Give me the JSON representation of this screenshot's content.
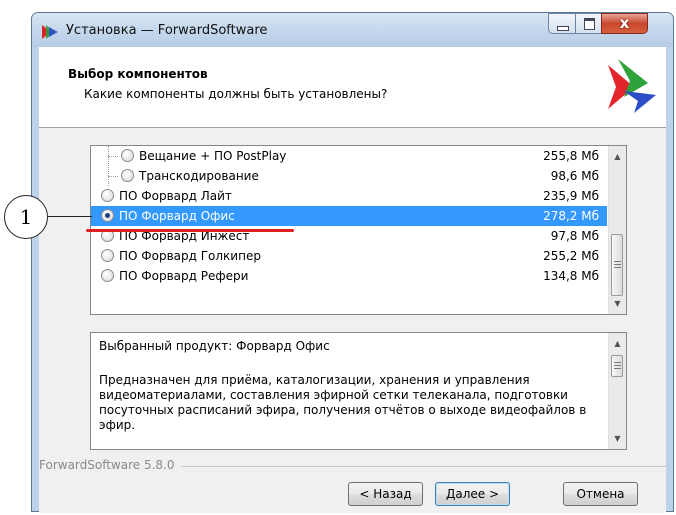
{
  "window": {
    "title": "Установка — ForwardSoftware",
    "controls": [
      "minimize",
      "maximize",
      "close"
    ],
    "close_glyph": "x"
  },
  "header": {
    "title": "Выбор компонентов",
    "subtitle": "Какие компоненты должны быть установлены?",
    "logo_icon": "tricolor-arrows-logo"
  },
  "components": {
    "items": [
      {
        "label": "Вещание + ПО PostPlay",
        "size": "255,8 Мб",
        "indent": true,
        "checked": false,
        "selected": false
      },
      {
        "label": "Транскодирование",
        "size": "98,6 Мб",
        "indent": true,
        "checked": false,
        "selected": false
      },
      {
        "label": "ПО Форвард Лайт",
        "size": "235,9 Мб",
        "indent": false,
        "checked": false,
        "selected": false
      },
      {
        "label": "ПО Форвард Офис",
        "size": "278,2 Мб",
        "indent": false,
        "checked": true,
        "selected": true
      },
      {
        "label": "ПО Форвард Инжест",
        "size": "97,8 Мб",
        "indent": false,
        "checked": false,
        "selected": false
      },
      {
        "label": "ПО Форвард Голкипер",
        "size": "255,2 Мб",
        "indent": false,
        "checked": false,
        "selected": false
      },
      {
        "label": "ПО Форвард Рефери",
        "size": "134,8 Мб",
        "indent": false,
        "checked": false,
        "selected": false
      }
    ]
  },
  "description": {
    "title": "Выбранный продукт: Форвард Офис",
    "text": "Предназначен для приёма, каталогизации, хранения и управления видеоматериалами, составления эфирной сетки телеканала, подготовки посуточных расписаний эфира, получения отчётов о выходе видеофайлов в эфир."
  },
  "brand": "ForwardSoftware 5.8.0",
  "buttons": {
    "back": "< Назад",
    "next": "Далее >",
    "cancel": "Отмена"
  },
  "annotation": {
    "number": "1",
    "underline_color": "#e02020"
  },
  "colors": {
    "selection": "#3399ff",
    "titlebar": "#c3d6ec"
  }
}
